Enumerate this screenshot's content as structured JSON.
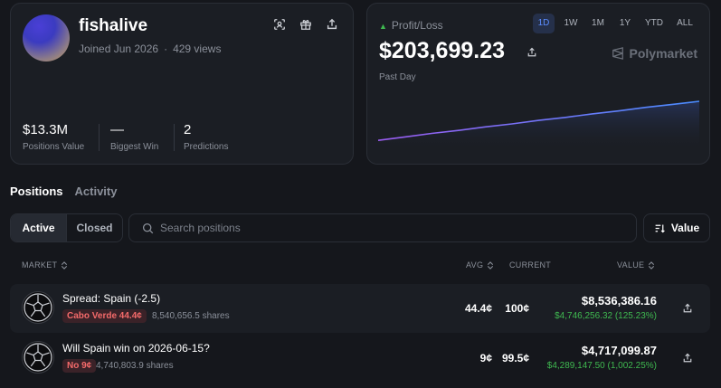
{
  "profile": {
    "username": "fishalive",
    "joined": "Joined Jun 2026",
    "views": "429 views",
    "stats": [
      {
        "value": "$13.3M",
        "label": "Positions Value"
      },
      {
        "value": "—",
        "label": "Biggest Win"
      },
      {
        "value": "2",
        "label": "Predictions"
      }
    ]
  },
  "pnl": {
    "label": "Profit/Loss",
    "value": "$203,699.23",
    "period": "Past Day",
    "brand": "Polymarket",
    "ranges": [
      "1D",
      "1W",
      "1M",
      "1Y",
      "YTD",
      "ALL"
    ],
    "active_range": "1D",
    "trend": [
      0.1,
      0.18,
      0.26,
      0.33,
      0.41,
      0.48,
      0.56,
      0.63,
      0.71,
      0.78,
      0.86,
      0.93,
      1.0
    ]
  },
  "tabs": {
    "positions": "Positions",
    "activity": "Activity"
  },
  "filter": {
    "active": "Active",
    "closed": "Closed"
  },
  "search": {
    "placeholder": "Search positions"
  },
  "sort": {
    "label": "Value"
  },
  "table": {
    "headers": {
      "market": "MARKET",
      "avg": "AVG",
      "current": "CURRENT",
      "value": "VALUE"
    },
    "rows": [
      {
        "title": "Spread: Spain (-2.5)",
        "outcome": "Cabo Verde 44.4¢",
        "shares": "8,540,656.5 shares",
        "avg": "44.4¢",
        "current": "100¢",
        "value": "$8,536,386.16",
        "gain": "$4,746,256.32 (125.23%)"
      },
      {
        "title": "Will Spain win on 2026-06-15?",
        "outcome": "No 9¢",
        "shares": "4,740,803.9 shares",
        "avg": "9¢",
        "current": "99.5¢",
        "value": "$4,717,099.87",
        "gain": "$4,289,147.50 (1,002.25%)"
      }
    ]
  },
  "colors": {
    "accent": "#5b8cff",
    "positive": "#3fb950",
    "negative": "#f46a6a"
  }
}
